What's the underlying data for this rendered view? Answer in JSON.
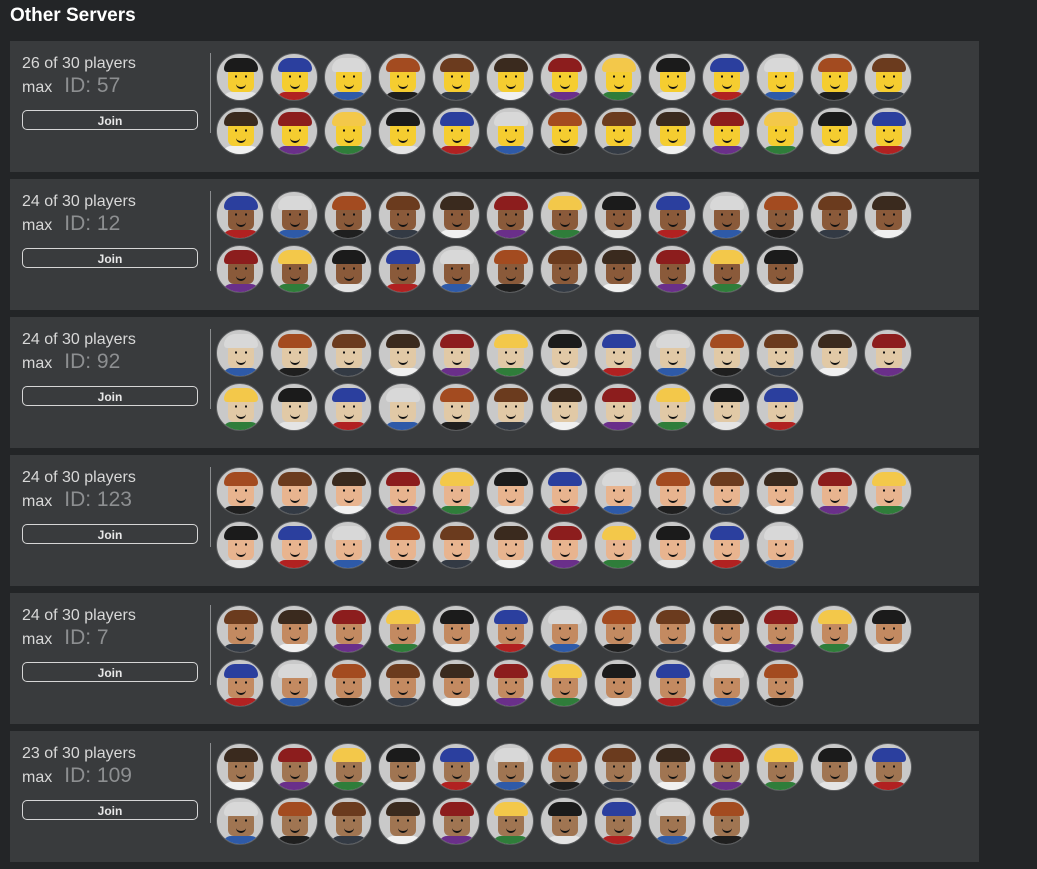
{
  "page": {
    "title": "Other Servers"
  },
  "servers": [
    {
      "players_text": "26 of 30 players",
      "max_text": "max",
      "id_text": "ID: 57",
      "join_label": "Join",
      "avatar_count": 26
    },
    {
      "players_text": "24 of 30 players",
      "max_text": "max",
      "id_text": "ID: 12",
      "join_label": "Join",
      "avatar_count": 24
    },
    {
      "players_text": "24 of 30 players",
      "max_text": "max",
      "id_text": "ID: 92",
      "join_label": "Join",
      "avatar_count": 24
    },
    {
      "players_text": "24 of 30 players",
      "max_text": "max",
      "id_text": "ID: 123",
      "join_label": "Join",
      "avatar_count": 24
    },
    {
      "players_text": "24 of 30 players",
      "max_text": "max",
      "id_text": "ID: 7",
      "join_label": "Join",
      "avatar_count": 24
    },
    {
      "players_text": "23 of 30 players",
      "max_text": "max",
      "id_text": "ID: 109",
      "join_label": "Join",
      "avatar_count": 23
    }
  ],
  "avatar_palette": {
    "skin": [
      "#f5cd30",
      "#a07552",
      "#e8b48f",
      "#8a5a3a",
      "#f2f2f2",
      "#c38a61",
      "#e1c9a6"
    ],
    "hair": [
      "#a34b20",
      "#1b1b1b",
      "#3a2a1e",
      "#d8d8d8",
      "#f3c84a",
      "#6b3b1e",
      "#2b3f9e",
      "#8c1d1d"
    ],
    "shirt": [
      "#1f1f1f",
      "#2e5aa8",
      "#b12121",
      "#e4e4e4",
      "#2f7d3a",
      "#6a2f8a",
      "#f0f0f0",
      "#333a44"
    ]
  }
}
